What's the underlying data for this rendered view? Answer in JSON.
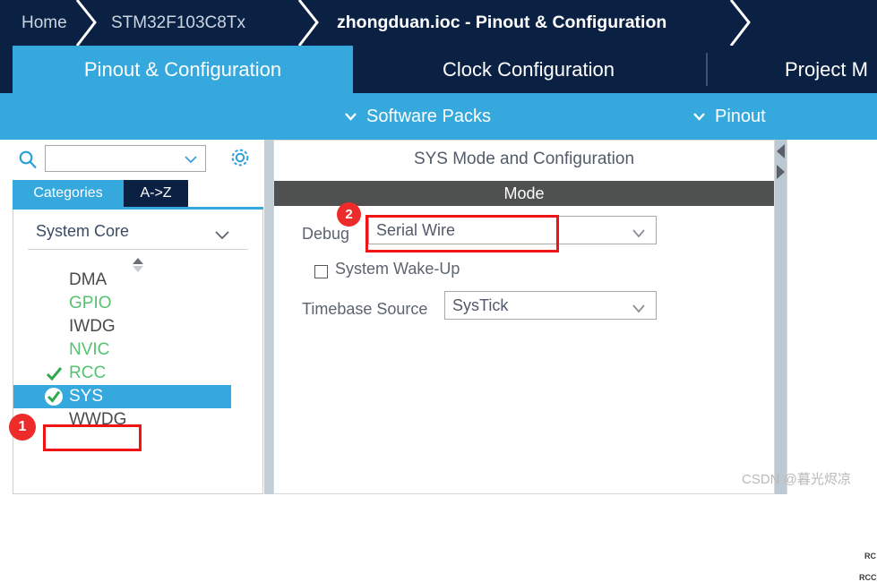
{
  "breadcrumb": {
    "items": [
      {
        "label": "Home",
        "active": false
      },
      {
        "label": "STM32F103C8Tx",
        "active": false
      },
      {
        "label": "zhongduan.ioc - Pinout & Configuration",
        "active": true
      }
    ]
  },
  "tabs": [
    {
      "label": "Pinout & Configuration",
      "selected": true
    },
    {
      "label": "Clock Configuration",
      "selected": false
    },
    {
      "label": "Project M",
      "selected": false
    }
  ],
  "subbar": {
    "items": [
      {
        "label": "Software Packs",
        "icon": "chevron-down-icon"
      },
      {
        "label": "Pinout",
        "icon": "chevron-down-icon"
      }
    ]
  },
  "sidebar": {
    "search": {
      "icon": "search-icon",
      "value": "",
      "placeholder": "",
      "chevron": "chevron-down-icon"
    },
    "settings_icon": "gear-icon",
    "minitabs": [
      {
        "label": "Categories",
        "selected": true
      },
      {
        "label": "A->Z",
        "selected": false
      }
    ],
    "group": {
      "label": "System Core",
      "chevron": "chevron-down-icon"
    },
    "scroll_icon": "updown-spinner-icon",
    "peripherals": [
      {
        "label": "DMA",
        "state": "none",
        "selected": false
      },
      {
        "label": "GPIO",
        "state": "partial",
        "selected": false
      },
      {
        "label": "IWDG",
        "state": "none",
        "selected": false
      },
      {
        "label": "NVIC",
        "state": "partial",
        "selected": false
      },
      {
        "label": "RCC",
        "state": "check",
        "selected": false
      },
      {
        "label": "SYS",
        "state": "check-circle",
        "selected": true
      },
      {
        "label": "WWDG",
        "state": "none",
        "selected": false
      }
    ]
  },
  "config_panel": {
    "title": "SYS Mode and Configuration",
    "mode_header": "Mode",
    "debug": {
      "label": "Debug",
      "value": "Serial Wire",
      "chevron": "chevron-down-icon"
    },
    "system_wakeup": {
      "label": "System Wake-Up",
      "checked": false
    },
    "timebase": {
      "label": "Timebase Source",
      "value": "SysTick",
      "chevron": "chevron-down-icon"
    },
    "scroll_left_icon": "triangle-left-icon",
    "scroll_right_icon": "triangle-right-icon"
  },
  "chip_labels": [
    {
      "text": "RC"
    },
    {
      "text": "RCC_"
    }
  ],
  "annotations": [
    {
      "number": "1",
      "target": "sidebar-item-sys"
    },
    {
      "number": "2",
      "target": "debug-combo"
    }
  ],
  "watermark": "CSDN @暮光烬凉",
  "colors": {
    "navy": "#0b2143",
    "accent_blue": "#35a8de",
    "mode_bar_gray": "#4e514f",
    "annotation_red": "#ee2b2b",
    "green": "#56c271"
  }
}
